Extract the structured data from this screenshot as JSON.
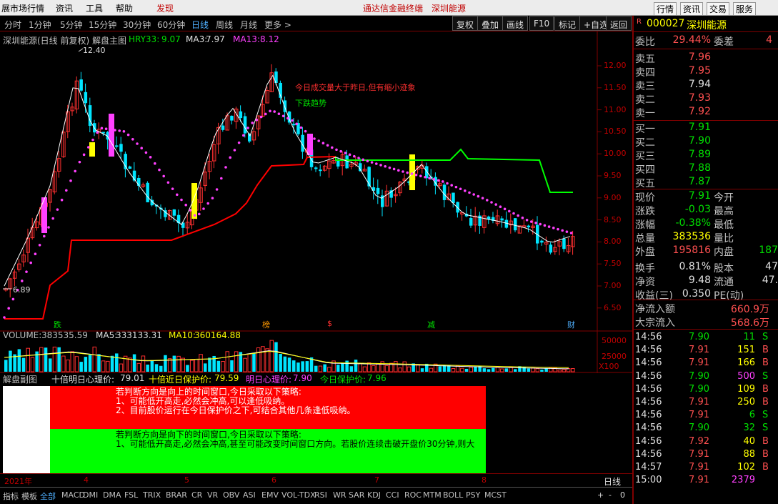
{
  "topmenu": {
    "items": [
      "展市场行情",
      "资讯",
      "工具",
      "帮助",
      "发现"
    ],
    "center_left": "通达信金融终端",
    "center_right": "深圳能源",
    "right_items": [
      "行情",
      "资讯",
      "交易",
      "服务"
    ]
  },
  "toolbar": {
    "periods": [
      "分时",
      "1分钟",
      "5分钟",
      "15分钟",
      "30分钟",
      "60分钟",
      "日线",
      "周线",
      "月线",
      "更多 >"
    ],
    "active": "日线",
    "buttons": [
      "复权",
      "叠加",
      "画线",
      "F10",
      "标记",
      "+自选",
      "返回"
    ]
  },
  "chart_header": {
    "title": "深圳能源(日线 前复权) 解盘主图",
    "hry_label": "HRY33:",
    "hry": "9.07",
    "ma3_label": "MA3:",
    "ma3": "7.97",
    "ma13_label": "MA13:",
    "ma13": "8.12"
  },
  "price_axis": [
    "12.00",
    "11.50",
    "11.00",
    "10.50",
    "10.00",
    "9.50",
    "9.00",
    "8.50",
    "8.00",
    "7.50",
    "7.00",
    "6.50"
  ],
  "annotations": {
    "max": "12.40",
    "min": "6.89",
    "note1": "今日成交量大于昨日,但有缩小迹象",
    "note2": "下跌趋势"
  },
  "markers": [
    "跌",
    "榜",
    "$",
    "减",
    "财"
  ],
  "volume": {
    "label": "VOLUME:",
    "value": "383535.59",
    "ma5_label": "MA5:",
    "ma5": "333133.31",
    "ma10_label": "MA10:",
    "ma10": "360164.88",
    "axis": [
      "50000",
      "25000",
      "X100"
    ]
  },
  "sub": {
    "title": "解盘副图",
    "l1_label": "十倍明日心理价:",
    "l1": "79.01",
    "l2_label": "十倍近日保护价:",
    "l2": "79.59",
    "l3_label": "明日心理价:",
    "l3": "7.90",
    "l4_label": "今日保护价:",
    "l4": "7.96",
    "red_text": [
      "若判断方向是向上的时间窗口,今日采取以下策略:",
      "1、可能低开高走,必然会冲高,可以逢低吸纳。",
      "2、目前股价运行在今日保护价之下,可结合其他几条逢低吸纳。"
    ],
    "green_text": [
      "若判断方向是向下的时间窗口,今日采取以下策略:",
      "1、可能低开高走,必然会冲高,甚至可能改变时间窗口方向。若股价连续击破开盘价30分钟,则大"
    ]
  },
  "dates": [
    "2021年",
    "4",
    "5",
    "6",
    "7",
    "8"
  ],
  "bottom": {
    "period": "日线",
    "tabs": [
      "指标",
      "模板",
      "全部",
      "MACD",
      "DMI",
      "DMA",
      "FSL",
      "TRIX",
      "BRAR",
      "CR",
      "VR",
      "OBV",
      "ASI",
      "EMV",
      "VOL-TDX",
      "RSI",
      "WR",
      "SAR",
      "KDJ",
      "CCI",
      "ROC",
      "MTM",
      "BOLL",
      "PSY",
      "MCST"
    ],
    "ctrl": [
      "+",
      "-",
      "0"
    ]
  },
  "quote": {
    "code": "000027",
    "name": "深圳能源",
    "weibi_label": "委比",
    "weibi": "29.44%",
    "weicha_label": "委差",
    "weicha": "4",
    "sells": [
      {
        "l": "卖五",
        "p": "7.96"
      },
      {
        "l": "卖四",
        "p": "7.95"
      },
      {
        "l": "卖三",
        "p": "7.94"
      },
      {
        "l": "卖二",
        "p": "7.93"
      },
      {
        "l": "卖一",
        "p": "7.92"
      }
    ],
    "buys": [
      {
        "l": "买一",
        "p": "7.91"
      },
      {
        "l": "买二",
        "p": "7.90"
      },
      {
        "l": "买三",
        "p": "7.89"
      },
      {
        "l": "买四",
        "p": "7.88"
      },
      {
        "l": "买五",
        "p": "7.87"
      }
    ],
    "stats": [
      {
        "l": "现价",
        "v": "7.91",
        "l2": "今开"
      },
      {
        "l": "涨跌",
        "v": "-0.03",
        "l2": "最高"
      },
      {
        "l": "涨幅",
        "v": "-0.38%",
        "l2": "最低"
      },
      {
        "l": "总量",
        "v": "383536",
        "l2": "量比"
      },
      {
        "l": "外盘",
        "v": "195816",
        "l2": "内盘",
        "v2": "187"
      },
      {
        "l": "换手",
        "v": "0.81%",
        "l2": "股本",
        "v2": "47"
      },
      {
        "l": "净资",
        "v": "9.48",
        "l2": "流通",
        "v2": "47."
      },
      {
        "l": "收益(三)",
        "v": "0.350",
        "l2": "PE(动)"
      }
    ],
    "flow": [
      {
        "l": "净流入额",
        "v": "660.9万"
      },
      {
        "l": "大宗流入",
        "v": "568.6万"
      }
    ],
    "ticks": [
      {
        "t": "14:56",
        "p": "7.90",
        "v": "11",
        "s": "S"
      },
      {
        "t": "14:56",
        "p": "7.91",
        "v": "151",
        "s": "B"
      },
      {
        "t": "14:56",
        "p": "7.91",
        "v": "166",
        "s": "B"
      },
      {
        "t": "14:56",
        "p": "7.90",
        "v": "500",
        "s": "S"
      },
      {
        "t": "14:56",
        "p": "7.90",
        "v": "109",
        "s": "B"
      },
      {
        "t": "14:56",
        "p": "7.91",
        "v": "250",
        "s": "B"
      },
      {
        "t": "14:56",
        "p": "7.91",
        "v": "6",
        "s": "S"
      },
      {
        "t": "14:56",
        "p": "7.90",
        "v": "32",
        "s": "S"
      },
      {
        "t": "14:56",
        "p": "7.92",
        "v": "40",
        "s": "B"
      },
      {
        "t": "14:56",
        "p": "7.91",
        "v": "88",
        "s": "B"
      },
      {
        "t": "14:57",
        "p": "7.91",
        "v": "102",
        "s": "B"
      },
      {
        "t": "15:00",
        "p": "7.91",
        "v": "2379",
        "s": ""
      }
    ]
  },
  "colors": {
    "up": "#ff3030",
    "down": "#00e5ff",
    "bg": "#000000",
    "green_band": "#00ff00",
    "red_band": "#ff0000"
  }
}
